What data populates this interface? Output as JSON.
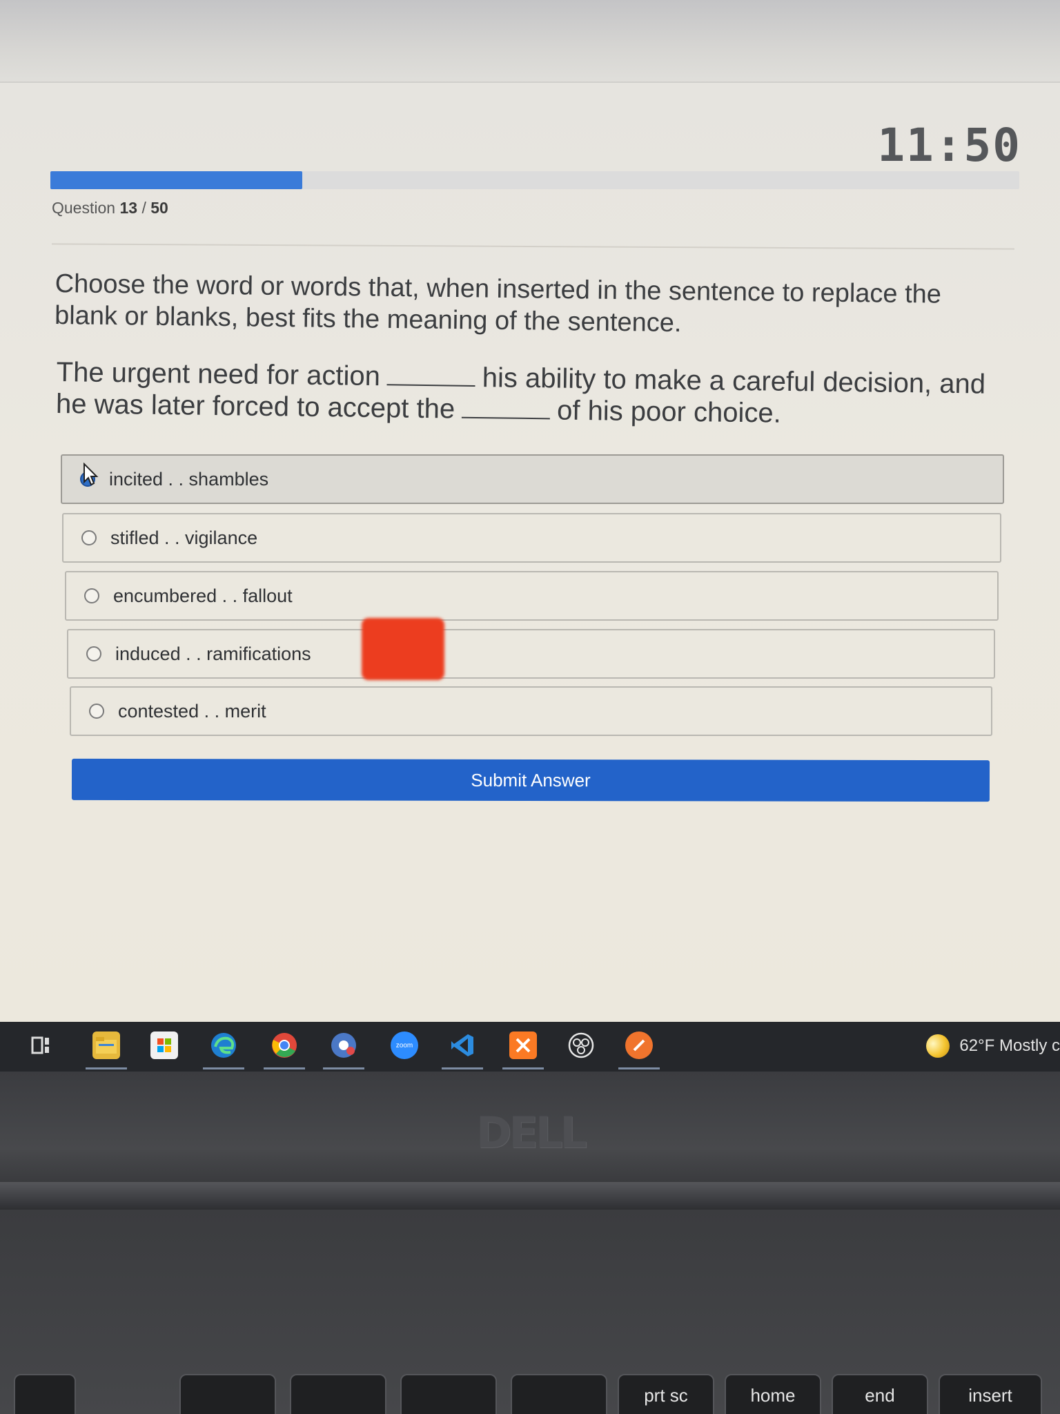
{
  "timer": "11:50",
  "progress": {
    "current": 13,
    "total": 50,
    "fraction": 0.26
  },
  "question_counter": {
    "prefix": "Question",
    "current": "13",
    "separator": "/",
    "total": "50"
  },
  "instructions": "Choose the word or words that, when inserted in the sentence to replace the blank or blanks, best fits the meaning of the sentence.",
  "sentence": {
    "part1": "The urgent need for action",
    "part2": "his ability to make a careful decision, and he was later forced to accept the",
    "part3": "of his poor choice."
  },
  "options": [
    {
      "label": "incited . . shambles",
      "selected": true
    },
    {
      "label": "stifled . . vigilance",
      "selected": false
    },
    {
      "label": "encumbered . . fallout",
      "selected": false
    },
    {
      "label": "induced . . ramifications",
      "selected": false
    },
    {
      "label": "contested . . merit",
      "selected": false
    }
  ],
  "submit_label": "Submit Answer",
  "taskbar": {
    "apps": [
      "task-view-icon",
      "file-explorer-icon",
      "microsoft-store-icon",
      "edge-icon",
      "chrome-icon",
      "chrome-profile-icon",
      "zoom-icon",
      "vscode-icon",
      "xampp-icon",
      "obs-icon",
      "app-orange-icon"
    ],
    "zoom_text": "zoom",
    "weather": "62°F  Mostly c"
  },
  "laptop": {
    "brand": "DELL",
    "keys": [
      "prt sc",
      "home",
      "end",
      "insert"
    ]
  },
  "colors": {
    "accent": "#2363c9",
    "progress": "#3a7bd9",
    "redaction": "#ec3d1f"
  }
}
